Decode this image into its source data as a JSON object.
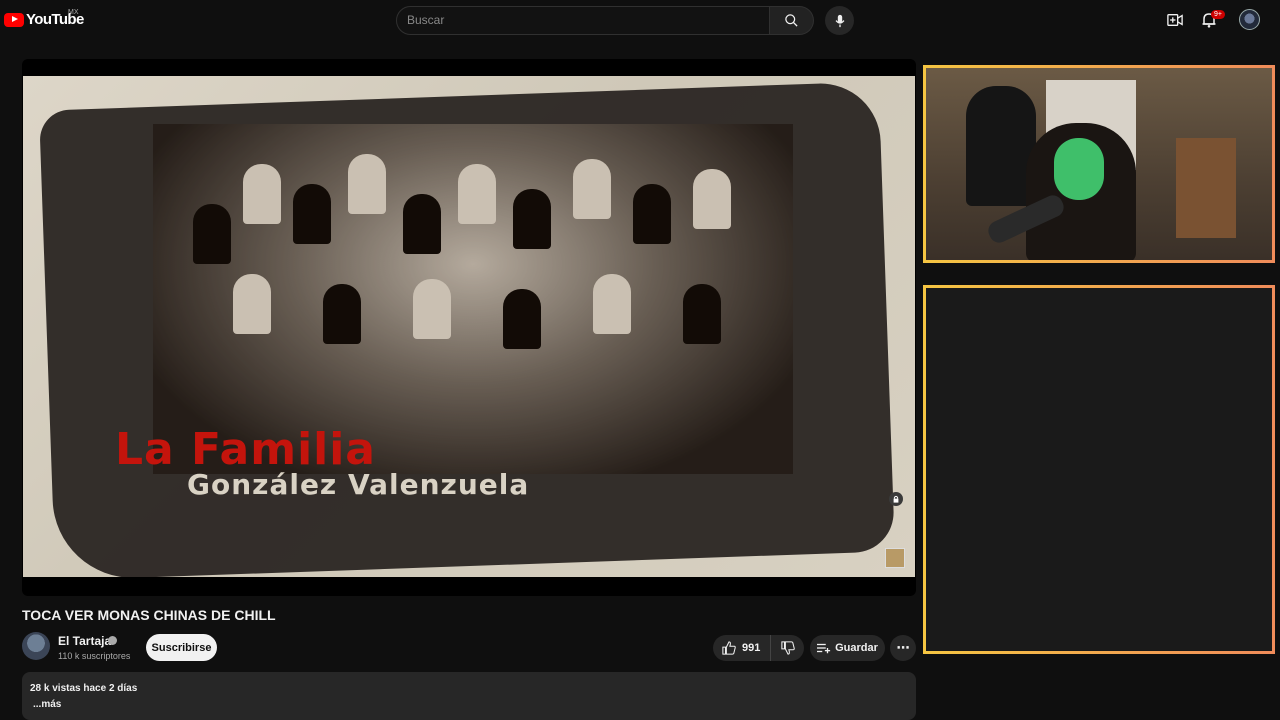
{
  "header": {
    "logo_text": "YouTube",
    "region": "MX",
    "search_placeholder": "Buscar",
    "notifications_badge": "9+"
  },
  "video": {
    "overlay_title_line1": "La Familia",
    "overlay_title_line2": "González Valenzuela",
    "title": "TOCA VER MONAS CHINAS DE CHILL"
  },
  "channel": {
    "name": "El Tartaja",
    "subscribers": "110 k suscriptores",
    "subscribe_label": "Suscribirse"
  },
  "actions": {
    "likes": "991",
    "save_label": "Guardar",
    "more_label": "⋯"
  },
  "description": {
    "stats": "28 k vistas  hace 2 días",
    "more_label": "...más"
  },
  "colors": {
    "accent_red": "#ff0000",
    "border_gradient_start": "#f5c542",
    "border_gradient_end": "#f08c5a",
    "background": "#0f0f0f"
  },
  "icons": [
    "youtube-logo-icon",
    "search-icon",
    "mic-icon",
    "create-icon",
    "bell-icon",
    "like-icon",
    "dislike-icon",
    "save-icon",
    "more-icon",
    "verified-icon",
    "lock-icon"
  ]
}
